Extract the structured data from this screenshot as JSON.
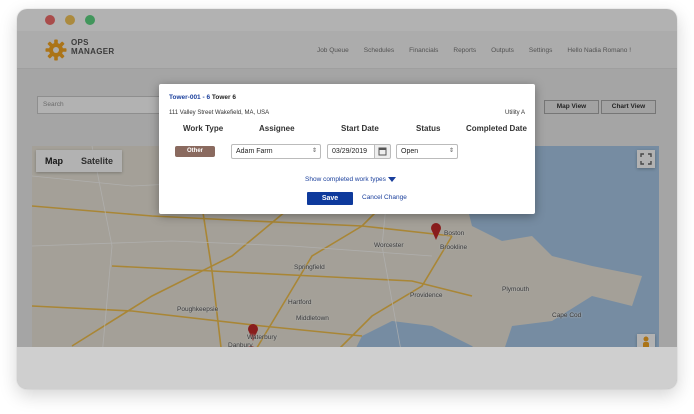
{
  "app": {
    "logo_line1": "OPS",
    "logo_line2": "MANAGER",
    "brand_color": "#f5a623"
  },
  "nav": {
    "items": [
      {
        "label": "Job Queue"
      },
      {
        "label": "Schedules"
      },
      {
        "label": "Financials"
      },
      {
        "label": "Reports"
      },
      {
        "label": "Outputs"
      },
      {
        "label": "Settings"
      },
      {
        "label": "Hello Nadia Romano !"
      }
    ]
  },
  "toolbar": {
    "search_placeholder": "Search",
    "map_view_label": "Map View",
    "chart_view_label": "Chart View"
  },
  "map": {
    "tab_map": "Map",
    "tab_satellite": "Satelite",
    "labels": [
      "Worcester",
      "Springfield",
      "Hartford",
      "Middletown",
      "Providence",
      "Boston",
      "Brookline",
      "Danbury",
      "Poughkeepsie",
      "Waterbury",
      "Plymouth",
      "Cape Cod"
    ],
    "water_color": "#a9c9e8",
    "marker_color": "#c52a2a"
  },
  "modal": {
    "tower_link": "Tower-001 - 6",
    "tower_name": "Tower 6",
    "address": "111 Valley Street Wakefield, MA, USA",
    "utility": "Utility A",
    "columns": {
      "work_type": "Work Type",
      "assignee": "Assignee",
      "start_date": "Start Date",
      "status": "Status",
      "completed_date": "Completed Date"
    },
    "row": {
      "work_type": "Other",
      "assignee": "Adam Farm",
      "start_date": "03/29/2019",
      "status": "Open"
    },
    "show_completed": "Show completed work types",
    "save_label": "Save",
    "cancel_label": "Cancel Change"
  }
}
